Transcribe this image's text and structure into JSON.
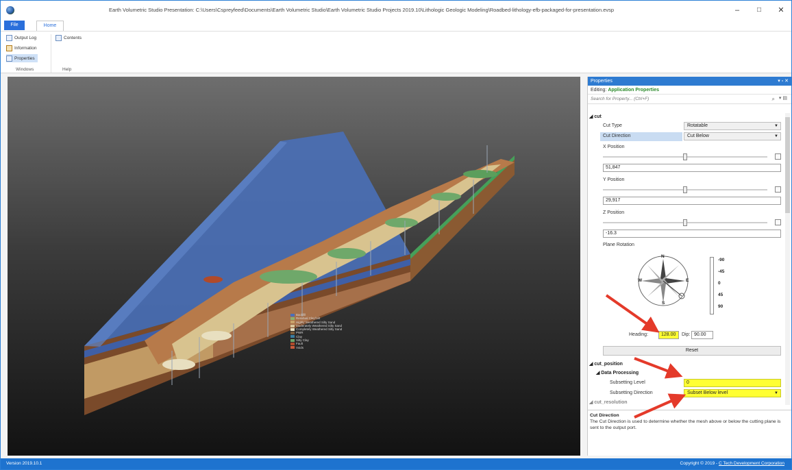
{
  "window": {
    "title": "Earth Volumetric Studio Presentation: C:\\Users\\Cspreyfeed\\Documents\\Earth Volumetric Studio\\Earth Volumetric Studio Projects 2019.10\\Lithologic Geologic Modeling\\Roadbed-lithology-efb-packaged-for-presentation.evsp",
    "minimize": "–",
    "maximize": "□",
    "close": "✕"
  },
  "ribbon": {
    "file_tab": "File",
    "home_tab": "Home",
    "output_log": "Output Log",
    "information": "Information",
    "properties": "Properties",
    "contents": "Contents",
    "group_windows": "Windows",
    "group_help": "Help"
  },
  "legend": {
    "items": [
      {
        "label": "Backfill",
        "color": "#4c6fb8"
      },
      {
        "label": "Residual Clay/Silt",
        "color": "#8fb06c"
      },
      {
        "label": "Highly Weathered Silty Sand",
        "color": "#c9a36a"
      },
      {
        "label": "Moderately Weathered Silty Sand",
        "color": "#d9c59a"
      },
      {
        "label": "Completely Weathered Silty Sand",
        "color": "#e8dfc0"
      },
      {
        "label": "PWR",
        "color": "#7a5a3a"
      },
      {
        "label": "Clay",
        "color": "#3b7ea1"
      },
      {
        "label": "Silty Clay",
        "color": "#6ea66a"
      },
      {
        "label": "Fault",
        "color": "#b04a2a"
      },
      {
        "label": "Voids",
        "color": "#c85a3a"
      }
    ]
  },
  "properties": {
    "panel_title": "Properties",
    "header_buttons": "▾ ▫ ✕",
    "editing_label": "Editing:",
    "editing_value": "Application Properties",
    "search_placeholder": "Search for Property... (Ctrl+F)",
    "search_icon": "⌕",
    "search_options": "▾ ▤",
    "cut": {
      "category": "cut",
      "cut_type_label": "Cut Type",
      "cut_type_value": "Rotatable",
      "cut_direction_label": "Cut Direction",
      "cut_direction_value": "Cut Below",
      "x_label": "X Position",
      "x_value": "51,847",
      "x_slider": 0.5,
      "y_label": "Y Position",
      "y_value": "29,917",
      "y_slider": 0.5,
      "z_label": "Z Position",
      "z_value": "-16.3",
      "z_slider": 0.5,
      "plane_rotation_label": "Plane Rotation",
      "compass": {
        "n": "N",
        "s": "S",
        "e": "E",
        "w": "W"
      },
      "dip_scale": [
        "-90",
        "-45",
        "0",
        "45",
        "90"
      ],
      "heading_label": "Heading:",
      "heading_value": "128.00",
      "dip_label": "Dip:",
      "dip_value": "90.00",
      "reset_label": "Reset"
    },
    "cut_position": {
      "category": "cut_position",
      "subcategory": "Data Processing",
      "subsetting_level_label": "Subsetting Level",
      "subsetting_level_value": "0",
      "subsetting_direction_label": "Subsetting Direction",
      "subsetting_direction_value": "Subset Below level",
      "next_category": "cut_resolution"
    },
    "description": {
      "title": "Cut Direction",
      "text": "The Cut Direction is used to determine whether the mesh above or below the cutting plane is sent to the output port."
    }
  },
  "status": {
    "version": "Version 2019.10.1",
    "copyright_prefix": "Copyright © 2019 - ",
    "copyright_link": "C Tech Development Corporation"
  },
  "colors": {
    "accent": "#1e73cf",
    "highlight": "#ffff33",
    "arrow": "#e43a2a"
  }
}
